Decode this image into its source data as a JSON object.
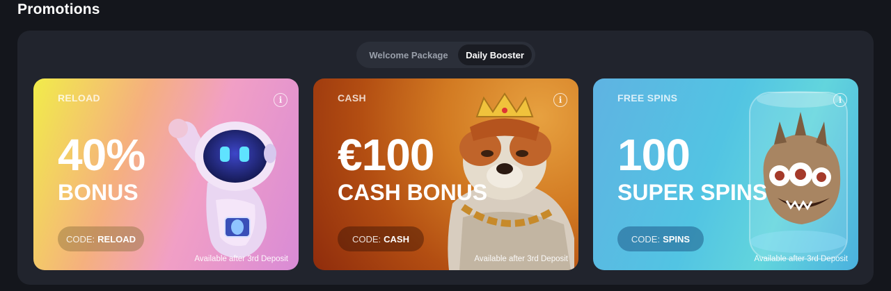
{
  "page_title": "Promotions",
  "tabs": [
    {
      "label": "Welcome Package",
      "active": false
    },
    {
      "label": "Daily Booster",
      "active": true
    }
  ],
  "cards": [
    {
      "type": "RELOAD",
      "amount": "40%",
      "subtitle": "BONUS",
      "code_label": "CODE:",
      "code": "RELOAD",
      "availability": "Available after 3rd Deposit",
      "illustration": "astronaut-robot-icon"
    },
    {
      "type": "CASH",
      "amount": "€100",
      "subtitle": "CASH BONUS",
      "code_label": "CODE:",
      "code": "CASH",
      "availability": "Available after 3rd Deposit",
      "illustration": "king-bulldog-icon"
    },
    {
      "type": "FREE SPINS",
      "amount": "100",
      "subtitle": "SUPER SPINS",
      "code_label": "CODE:",
      "code": "SPINS",
      "availability": "Available after 3rd Deposit",
      "illustration": "jar-monster-icon"
    }
  ],
  "info_glyph": "i",
  "colors": {
    "page_bg": "#14161c",
    "panel_bg": "#21242d",
    "tab_active_bg": "#1a1c23"
  }
}
